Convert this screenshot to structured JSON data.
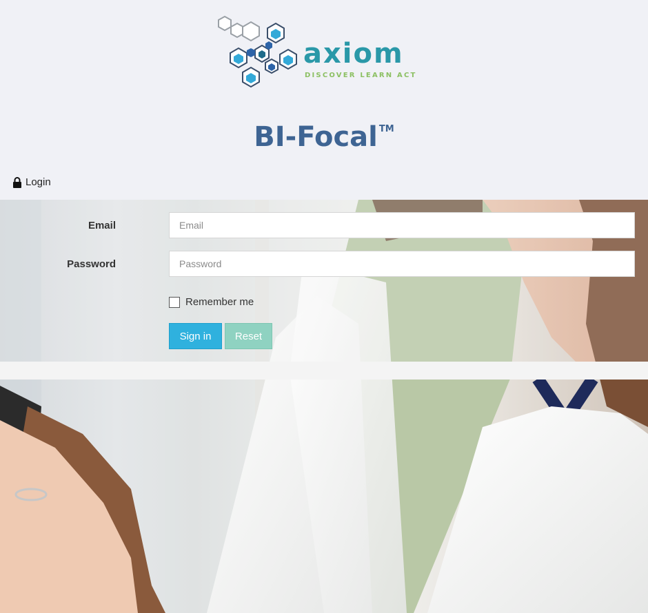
{
  "brand": {
    "logo_word": "axiom",
    "tagline": "DISCOVER LEARN ACT",
    "product_name": "BI-Focal",
    "trademark": "TM"
  },
  "login": {
    "heading": "Login",
    "email_label": "Email",
    "email_placeholder": "Email",
    "email_value": "",
    "password_label": "Password",
    "password_placeholder": "Password",
    "password_value": "",
    "remember_label": "Remember me",
    "remember_checked": false,
    "signin_label": "Sign in",
    "reset_label": "Reset"
  },
  "icons": [
    "lock-icon",
    "checkbox"
  ],
  "colors": {
    "logo_teal": "#2a98a8",
    "logo_green": "#8cc063",
    "title_blue": "#3e6493",
    "signin_button": "#2fb1de",
    "reset_button": "#8fd2c1",
    "page_background": "#f0f1f6"
  }
}
